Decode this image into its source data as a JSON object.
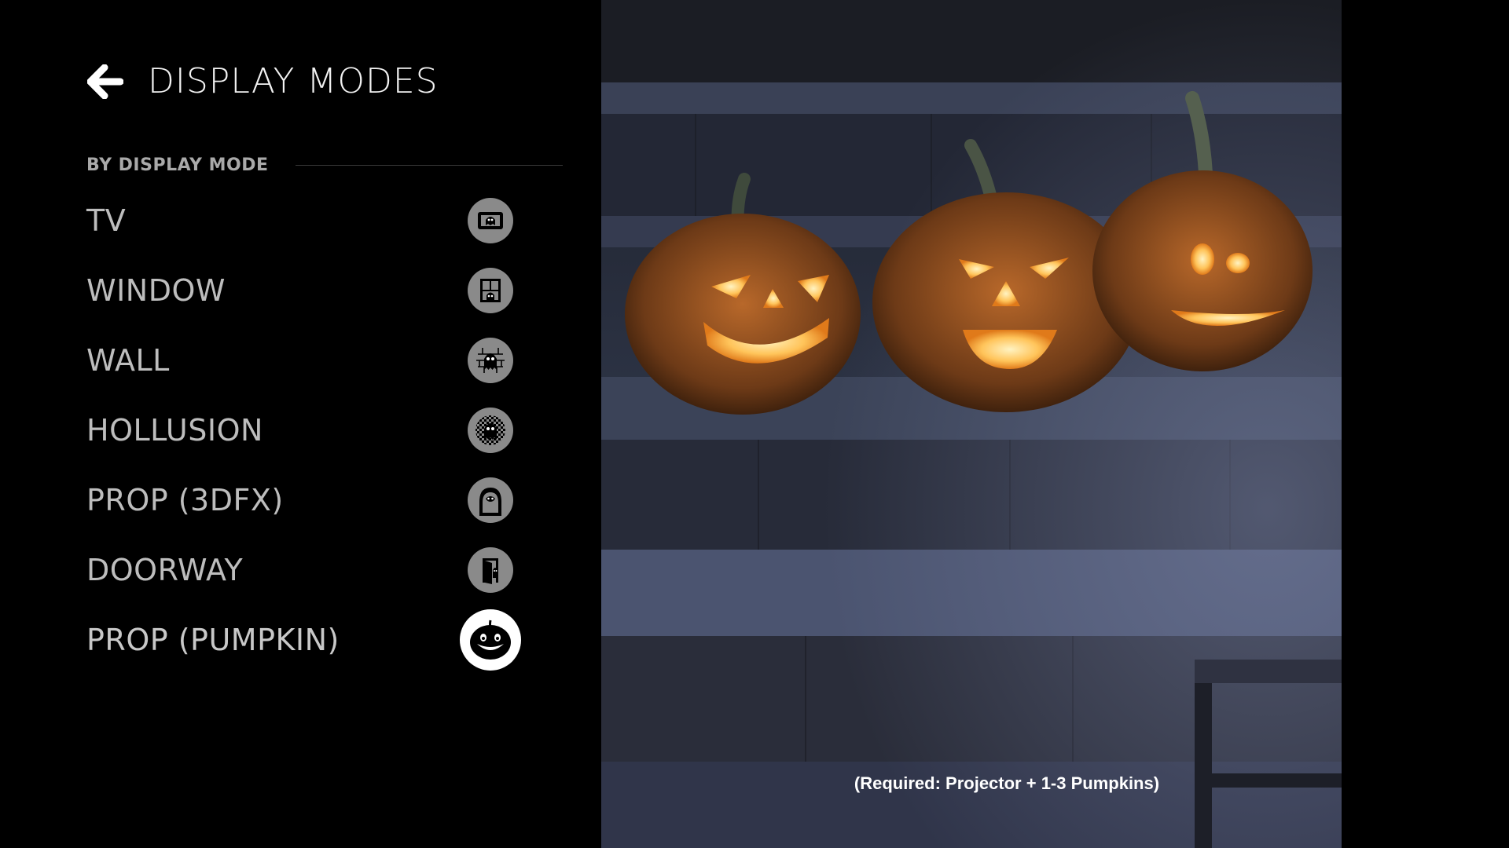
{
  "header": {
    "title": "DISPLAY MODES",
    "back_icon": "back-arrow-icon"
  },
  "section": {
    "label": "BY DISPLAY MODE"
  },
  "modes": [
    {
      "label": "TV",
      "icon": "tv-ghost-icon",
      "selected": false
    },
    {
      "label": "WINDOW",
      "icon": "window-ghost-icon",
      "selected": false
    },
    {
      "label": "WALL",
      "icon": "wall-ghost-icon",
      "selected": false
    },
    {
      "label": "HOLLUSION",
      "icon": "hollusion-ghost-icon",
      "selected": false
    },
    {
      "label": "PROP (3DFX)",
      "icon": "prop-ghost-icon",
      "selected": false
    },
    {
      "label": "DOORWAY",
      "icon": "doorway-ghost-icon",
      "selected": false
    },
    {
      "label": "PROP (PUMPKIN)",
      "icon": "pumpkin-face-icon",
      "selected": true
    }
  ],
  "preview": {
    "caption": "(Required: Projector + 1-3 Pumpkins)"
  },
  "colors": {
    "background": "#000000",
    "icon_idle": "#8a8a8a",
    "icon_selected": "#ffffff",
    "label": "#bdbdbd",
    "pumpkin_glow": "#ffd27a"
  }
}
